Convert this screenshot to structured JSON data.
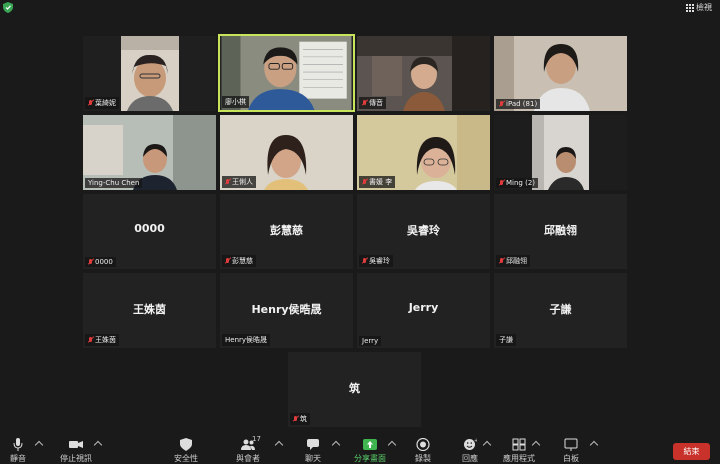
{
  "top_bar": {
    "view_label": "檢視"
  },
  "participants": [
    {
      "name": "葉綺妮",
      "muted": true,
      "video": true
    },
    {
      "name": "廖小棋",
      "muted": false,
      "video": true,
      "active_speaker": true
    },
    {
      "name": "傳音",
      "muted": true,
      "video": true
    },
    {
      "name": "iPad (81)",
      "muted": true,
      "video": true
    },
    {
      "name": "Ying-Chu Chen",
      "muted": false,
      "video": true
    },
    {
      "name": "王俐人",
      "muted": true,
      "video": true
    },
    {
      "name": "書媛 李",
      "muted": true,
      "video": true
    },
    {
      "name": "Ming (2)",
      "muted": true,
      "video": true
    },
    {
      "name": "0000",
      "display": "0000",
      "muted": true,
      "video": false
    },
    {
      "name": "彭慧慈",
      "display": "彭慧慈",
      "muted": true,
      "video": false
    },
    {
      "name": "吳睿玲",
      "display": "吳睿玲",
      "muted": true,
      "video": false
    },
    {
      "name": "邱融翎",
      "display": "邱融翎",
      "muted": true,
      "video": false
    },
    {
      "name": "王姝茵",
      "display": "王姝茵",
      "muted": true,
      "video": false
    },
    {
      "name": "Henry侯晧晟",
      "display": "Henry侯晧晟",
      "muted": false,
      "video": false
    },
    {
      "name": "Jerry",
      "display": "Jerry",
      "muted": false,
      "video": false
    },
    {
      "name": "子謙",
      "display": "子謙",
      "muted": false,
      "video": false
    },
    {
      "name": "筑",
      "display": "筑",
      "muted": true,
      "video": false
    }
  ],
  "toolbar": {
    "mute": "靜音",
    "stop_video": "停止視訊",
    "security": "安全性",
    "participants": "與會者",
    "participants_count": "17",
    "chat": "聊天",
    "share_screen": "分享畫面",
    "record": "錄製",
    "reactions": "回應",
    "apps": "應用程式",
    "whiteboard": "白板",
    "end": "結束"
  },
  "colors": {
    "background": "#1a1a1a",
    "tile": "#222222",
    "active_border": "#c8e45a",
    "end_button": "#c8322b",
    "share_green": "#5bcf6a",
    "muted_red": "#e03c3c"
  }
}
